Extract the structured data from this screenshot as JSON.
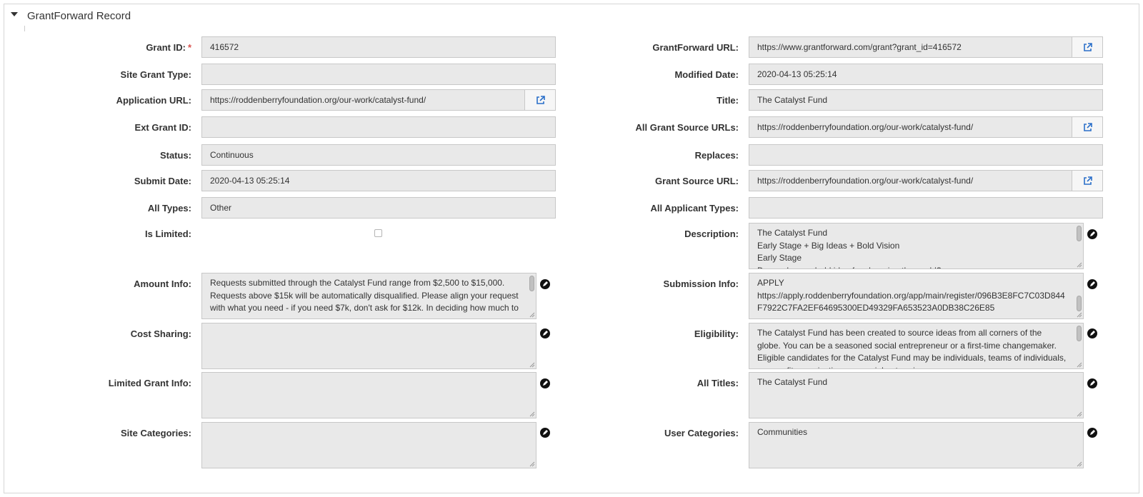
{
  "section": {
    "title": "GrantForward Record"
  },
  "left": {
    "grant_id": {
      "label": "Grant ID:",
      "required": "*",
      "value": "416572"
    },
    "site_grant_type": {
      "label": "Site Grant Type:",
      "value": ""
    },
    "application_url": {
      "label": "Application URL:",
      "value": "https://roddenberryfoundation.org/our-work/catalyst-fund/"
    },
    "ext_grant_id": {
      "label": "Ext Grant ID:",
      "value": ""
    },
    "status": {
      "label": "Status:",
      "value": "Continuous"
    },
    "submit_date": {
      "label": "Submit Date:",
      "value": "2020-04-13 05:25:14"
    },
    "all_types": {
      "label": "All Types:",
      "value": "Other"
    },
    "is_limited": {
      "label": "Is Limited:",
      "checked": false
    },
    "amount_info": {
      "label": "Amount Info:",
      "value": "Requests submitted through the Catalyst Fund range from $2,500 to $15,000. Requests above $15k will be automatically disqualified. Please align your request with what you need - if you need $7k, don't ask for $12k. In deciding how much to"
    },
    "cost_sharing": {
      "label": "Cost Sharing:",
      "value": ""
    },
    "limited_grant_info": {
      "label": "Limited Grant Info:",
      "value": ""
    },
    "site_categories": {
      "label": "Site Categories:",
      "value": ""
    }
  },
  "right": {
    "grantforward_url": {
      "label": "GrantForward URL:",
      "value": "https://www.grantforward.com/grant?grant_id=416572"
    },
    "modified_date": {
      "label": "Modified Date:",
      "value": "2020-04-13 05:25:14"
    },
    "title": {
      "label": "Title:",
      "value": "The Catalyst Fund"
    },
    "all_grant_source_urls": {
      "label": "All Grant Source URLs:",
      "value": "https://roddenberryfoundation.org/our-work/catalyst-fund/"
    },
    "replaces": {
      "label": "Replaces:",
      "value": ""
    },
    "grant_source_url": {
      "label": "Grant Source URL:",
      "value": "https://roddenberryfoundation.org/our-work/catalyst-fund/"
    },
    "all_applicant_types": {
      "label": "All Applicant Types:",
      "value": ""
    },
    "description": {
      "label": "Description:",
      "value": "The Catalyst Fund\nEarly Stage + Big Ideas + Bold Vision\nEarly Stage\nDo you have a bold idea for changing the world?"
    },
    "submission_info": {
      "label": "Submission Info:",
      "value": "APPLY\nhttps://apply.roddenberryfoundation.org/app/main/register/096B3E8FC7C03D844F7922C7FA2EF64695300ED49329FA653523A0DB38C26E85"
    },
    "eligibility": {
      "label": "Eligibility:",
      "value": "The Catalyst Fund has been created to source ideas from all corners of the globe. You can be a seasoned social entrepreneur or a first-time changemaker. Eligible candidates for the Catalyst Fund may be individuals, teams of individuals, non-profit organizations, or social enterprises."
    },
    "all_titles": {
      "label": "All Titles:",
      "value": "The Catalyst Fund"
    },
    "user_categories": {
      "label": "User Categories:",
      "value": "Communities"
    }
  },
  "icons": {
    "external_link": "external-link-icon",
    "edit": "pencil-edit-icon",
    "collapse": "caret-down-icon"
  }
}
